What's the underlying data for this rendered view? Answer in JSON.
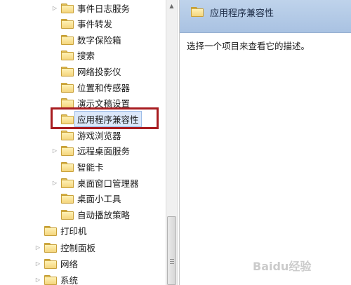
{
  "tree": {
    "items": [
      {
        "label": "事件日志服务",
        "expandable": true
      },
      {
        "label": "事件转发",
        "expandable": false
      },
      {
        "label": "数字保险箱",
        "expandable": false
      },
      {
        "label": "搜索",
        "expandable": false
      },
      {
        "label": "网络投影仪",
        "expandable": false
      },
      {
        "label": "位置和传感器",
        "expandable": false
      },
      {
        "label": "演示文稿设置",
        "expandable": false
      },
      {
        "label": "应用程序兼容性",
        "expandable": false,
        "selected": true
      },
      {
        "label": "游戏浏览器",
        "expandable": false
      },
      {
        "label": "远程桌面服务",
        "expandable": true
      },
      {
        "label": "智能卡",
        "expandable": false
      },
      {
        "label": "桌面窗口管理器",
        "expandable": true
      },
      {
        "label": "桌面小工具",
        "expandable": false
      },
      {
        "label": "自动播放策略",
        "expandable": false
      },
      {
        "label": "打印机",
        "expandable": false
      },
      {
        "label": "控制面板",
        "expandable": true
      },
      {
        "label": "网络",
        "expandable": true
      },
      {
        "label": "系统",
        "expandable": true
      }
    ]
  },
  "description": {
    "title": "应用程序兼容性",
    "text": "选择一个项目来查看它的描述。"
  },
  "watermark": "Baidu经验"
}
